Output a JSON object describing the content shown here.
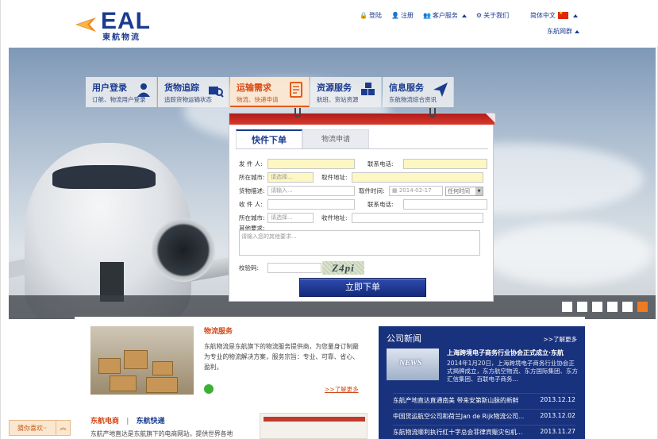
{
  "brand": {
    "name": "EAL",
    "cn": "東航物流"
  },
  "topnav": {
    "login": "登陆",
    "register": "注册",
    "service": "客户服务",
    "about": "关于我们"
  },
  "lang": "简体中文",
  "group": "东航网群",
  "services": [
    {
      "title": "用户登录",
      "sub": "订舱、物流用户登录"
    },
    {
      "title": "货物追踪",
      "sub": "追踪货物运输状态"
    },
    {
      "title": "运输需求",
      "sub": "物流、快递申请"
    },
    {
      "title": "资源服务",
      "sub": "航班、货站资源"
    },
    {
      "title": "信息服务",
      "sub": "东航物流综合资讯"
    }
  ],
  "form": {
    "tab_active": "快件下单",
    "tab_other": "物流申请",
    "sender": "发 件 人:",
    "contact_phone": "联系电话:",
    "city": "所在城市:",
    "city_ph": "请选择...",
    "pickup_addr": "取件地址:",
    "goods": "货物描述:",
    "goods_ph": "请输入...",
    "pickup_time": "取件时间:",
    "date": "2014-02-17",
    "time_ph": "任何时间",
    "receiver": "收 件 人:",
    "receiver_phone": "联系电话:",
    "city2": "所在城市:",
    "recv_addr": "收件地址:",
    "other": "其他要求:",
    "other_ph": "请输入您的其他要求...",
    "captcha_label": "校验码:",
    "captcha": "Z4pi",
    "submit": "立即下单"
  },
  "logistics": {
    "title": "物流服务",
    "text": "东航物流是东航旗下的物流服务提供商，为您量身订制最为专业的物流解决方案，服务宗旨：专业、可靠、省心、盈利。",
    "more": ">>了解更多"
  },
  "ec": {
    "a": "东航电商",
    "sep": "|",
    "b": "东航快递",
    "text": "东航产地直达是东航旗下的电商网站，提供世界各地"
  },
  "news": {
    "title": "公司新闻",
    "more": ">>了解更多",
    "head": "上海跨境电子商务行业协会正式成立·东航",
    "body": "2014年1月20日，上海跨境电子商务行业协会正式揭牌成立，东方航空物流、东方国际集团、东方汇信集团、百联电子商务...",
    "items": [
      {
        "t": "东航产地直达直通南美 带来安第斯山脉的新鲜",
        "d": "2013.12.12"
      },
      {
        "t": "中国货运航空公司和荷兰Jan de Rijk物流公司...",
        "d": "2013.12.02"
      },
      {
        "t": "东航物流顺利执行红十字总会菲律宾赈灾包机...",
        "d": "2013.11.27"
      }
    ]
  },
  "guess": "猜你喜欢··",
  "slides": 6,
  "slide_active": 6
}
